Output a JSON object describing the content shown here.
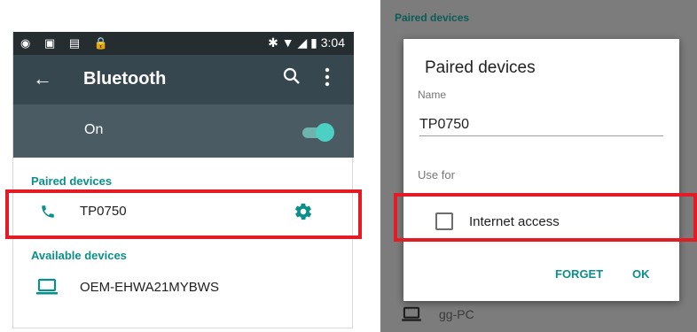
{
  "left": {
    "statusbar": {
      "icons": [
        "android-icon",
        "image-icon",
        "doc-icon",
        "lock-icon"
      ],
      "right_icons": [
        "bluetooth-icon",
        "wifi-icon",
        "signal-icon",
        "battery-icon"
      ],
      "time": "3:04"
    },
    "appbar": {
      "title": "Bluetooth",
      "back_icon": "arrow-back-icon",
      "search_icon": "search-icon",
      "menu_icon": "more-vert-icon"
    },
    "toggle": {
      "label": "On",
      "state": "on"
    },
    "paired_header": "Paired devices",
    "paired_device": {
      "name": "TP0750",
      "icon": "phone-icon",
      "settings_icon": "gear-icon"
    },
    "available_header": "Available devices",
    "available_device": {
      "name": "OEM-EHWA21MYBWS",
      "icon": "laptop-icon"
    }
  },
  "right": {
    "bg": {
      "header": "Paired devices",
      "device": "gg-PC"
    },
    "dialog": {
      "title": "Paired devices",
      "name_label": "Name",
      "name_value": "TP0750",
      "use_for_label": "Use for",
      "checkbox_label": "Internet access",
      "forget_button": "FORGET",
      "ok_button": "OK"
    }
  },
  "colors": {
    "accent": "#0b8f8a",
    "highlight": "#e21b24",
    "appbar": "#37474f"
  }
}
